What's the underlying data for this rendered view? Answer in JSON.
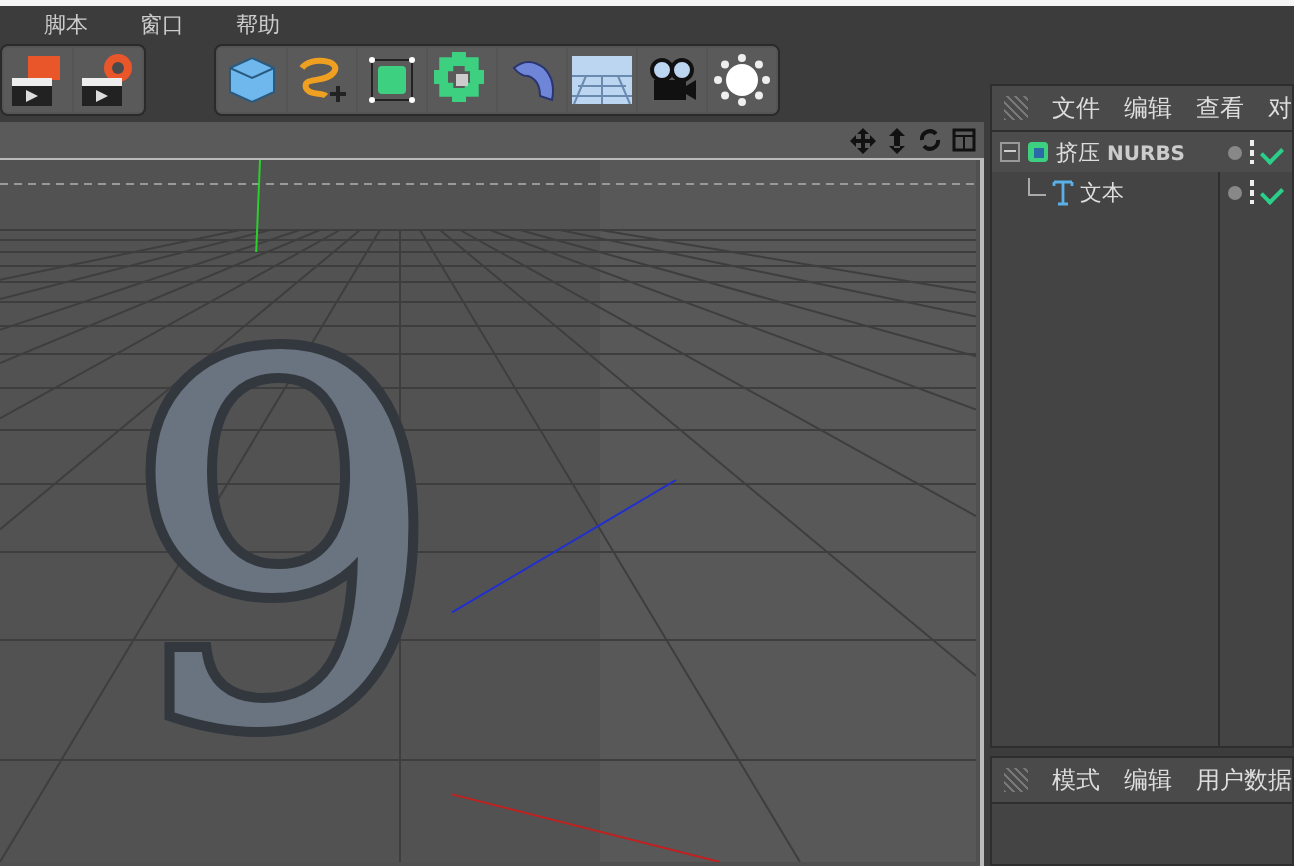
{
  "menu_bar": [
    "脚本",
    "窗口",
    "帮助"
  ],
  "toolbar_groups": [
    [
      {
        "kind": "clapper-render"
      },
      {
        "kind": "clapper-settings"
      }
    ],
    [
      {
        "kind": "cube"
      },
      {
        "kind": "spline"
      },
      {
        "kind": "generator"
      },
      {
        "kind": "array"
      },
      {
        "kind": "deformer"
      },
      {
        "kind": "floor"
      },
      {
        "kind": "camera"
      },
      {
        "kind": "light"
      }
    ]
  ],
  "viewport": {
    "scene_text": "9"
  },
  "object_manager": {
    "menus": [
      "文件",
      "编辑",
      "查看",
      "对"
    ],
    "objects": [
      {
        "name": "挤压 ",
        "name_bold": "NURBS",
        "kind": "extrude",
        "expanded": true,
        "selected": true,
        "enabled": true,
        "children": [
          {
            "name": "文本",
            "kind": "text",
            "selected": false,
            "enabled": true
          }
        ]
      }
    ]
  },
  "attribute_manager": {
    "menus": [
      "模式",
      "编辑",
      "用户数据"
    ]
  }
}
